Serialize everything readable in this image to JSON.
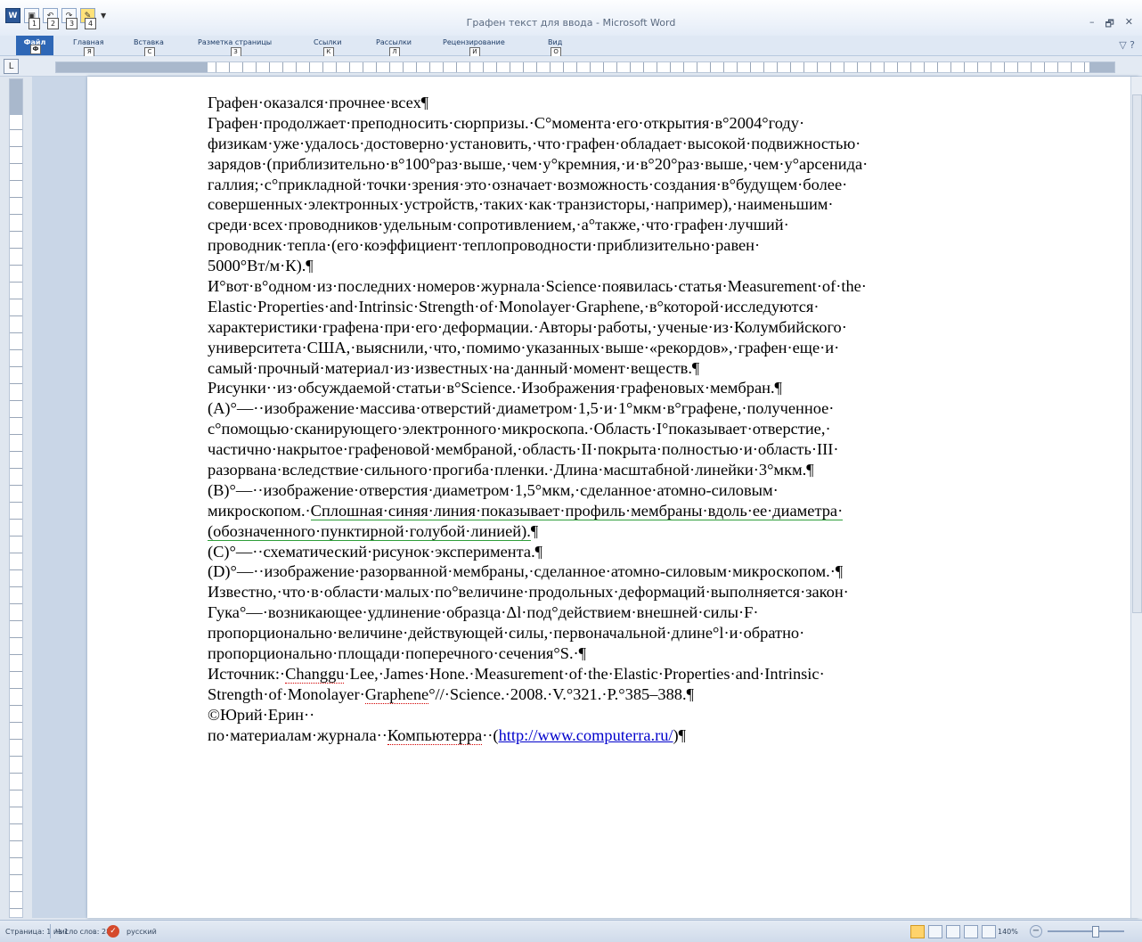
{
  "window": {
    "title": "Графен текст для  ввода - Microsoft Word",
    "controls": [
      "–",
      "🗗",
      "✕"
    ]
  },
  "qat": {
    "buttons": [
      {
        "icon": "word-logo-icon",
        "glyph": "W",
        "key": ""
      },
      {
        "icon": "save-icon",
        "glyph": "▣",
        "key": "1"
      },
      {
        "icon": "undo-icon",
        "glyph": "↶",
        "key": "2"
      },
      {
        "icon": "redo-icon",
        "glyph": "↷",
        "key": "3"
      },
      {
        "icon": "custom-icon",
        "glyph": "✎",
        "key": "4"
      }
    ],
    "more": "▼"
  },
  "ribbon": {
    "tabs": [
      {
        "label": "Файл",
        "key": "Ф"
      },
      {
        "label": "Главная",
        "key": "Я"
      },
      {
        "label": "Вставка",
        "key": "С"
      },
      {
        "label": "Разметка страницы",
        "key": "З"
      },
      {
        "label": "Ссылки",
        "key": "К"
      },
      {
        "label": "Рассылки",
        "key": "Л"
      },
      {
        "label": "Рецензирование",
        "key": "И"
      },
      {
        "label": "Вид",
        "key": "О"
      }
    ],
    "right": "▽ ?"
  },
  "ruler": {
    "corner": "L"
  },
  "document": {
    "lines": [
      {
        "segments": [
          {
            "text": "Графен·оказался·прочнее·всех¶"
          }
        ]
      },
      {
        "segments": [
          {
            "text": "Графен·продолжает·преподносить·сюрпризы.·С°момента·его·открытия·в°2004°году·"
          }
        ]
      },
      {
        "segments": [
          {
            "text": "физикам·уже·удалось·достоверно·установить,·что·графен·обладает·высокой·подвижностью·"
          }
        ]
      },
      {
        "segments": [
          {
            "text": "зарядов·(приблизительно·в°100°раз·выше,·чем·у°кремния,·и·в°20°раз·выше,·чем·у°арсенида·"
          }
        ]
      },
      {
        "segments": [
          {
            "text": "галлия;·с°прикладной·точки·зрения·это·означает·возможность·создания·в°будущем·более·"
          }
        ]
      },
      {
        "segments": [
          {
            "text": "совершенных·электронных·устройств,·таких·как·транзисторы,·например),·наименьшим·"
          }
        ]
      },
      {
        "segments": [
          {
            "text": "среди·всех·проводников·удельным·сопротивлением,·а°также,·что·графен·лучший·"
          }
        ]
      },
      {
        "segments": [
          {
            "text": "проводник·тепла·(его·коэффициент·теплопроводности·приблизительно·равен·"
          }
        ]
      },
      {
        "segments": [
          {
            "text": "5000°Вт/м·К).¶"
          }
        ]
      },
      {
        "segments": [
          {
            "text": "И°вот·в°одном·из·последних·номеров·журнала·Science·появилась·статья·Measurement·of·the·"
          }
        ]
      },
      {
        "segments": [
          {
            "text": "Elastic·Properties·and·Intrinsic·Strength·of·Monolayer·Graphene,·в°которой·исследуются·"
          }
        ]
      },
      {
        "segments": [
          {
            "text": "характеристики·графена·при·его·деформации.·Авторы·работы,·ученые·из·Колумбийского·"
          }
        ]
      },
      {
        "segments": [
          {
            "text": "университета·США,·выяснили,·что,·помимо·указанных·выше·«рекордов»,·графен·еще·и·"
          }
        ]
      },
      {
        "segments": [
          {
            "text": "самый·прочный·материал·из·известных·на·данный·момент·веществ.¶"
          }
        ]
      },
      {
        "segments": [
          {
            "text": "Рисунки··из·обсуждаемой·статьи·в°Science.·Изображения·графеновых·мембран.¶"
          }
        ]
      },
      {
        "segments": [
          {
            "text": "(A)°—··изображение·массива·отверстий·диаметром·1,5·и·1°мкм·в°графене,·полученное·"
          }
        ]
      },
      {
        "segments": [
          {
            "text": "с°помощью·сканирующего·электронного·микроскопа.·Область·I°показывает·отверстие,·"
          }
        ]
      },
      {
        "segments": [
          {
            "text": "частично·накрытое·графеновой·мембраной,·область·II·покрыта·полностью·и·область·III·"
          }
        ]
      },
      {
        "segments": [
          {
            "text": "разорвана·вследствие·сильного·прогиба·пленки.·Длина·масштабной·линейки·3°мкм.¶"
          }
        ]
      },
      {
        "segments": [
          {
            "text": "(B)°—··изображение·отверстия·диаметром·1,5°мкм,·сделанное·атомно-силовым·"
          }
        ]
      },
      {
        "segments": [
          {
            "text": "микроскопом.·"
          },
          {
            "text": "Сплошная·синяя·линия·показывает·профиль·мембраны·вдоль·ее·диаметра·",
            "style": "green"
          }
        ]
      },
      {
        "segments": [
          {
            "text": "(обозначенного·пунктирной·голубой·линией).",
            "style": "green"
          },
          {
            "text": "¶"
          }
        ]
      },
      {
        "segments": [
          {
            "text": "(C)°—··схематический·рисунок·эксперимента.¶"
          }
        ]
      },
      {
        "segments": [
          {
            "text": "(D)°—··изображение·разорванной·мембраны,·сделанное·атомно-силовым·микроскопом.·¶"
          }
        ]
      },
      {
        "segments": [
          {
            "text": "Известно,·что·в·области·малых·по°величине·продольных·деформаций·выполняется·закон·"
          }
        ]
      },
      {
        "segments": [
          {
            "text": "Гука°—·возникающее·удлинение·образца·Δl·под°действием·внешней·силы·F·"
          }
        ]
      },
      {
        "segments": [
          {
            "text": "пропорционально·величине·действующей·силы,·первоначальной·длине°l·и·обратно·"
          }
        ]
      },
      {
        "segments": [
          {
            "text": "пропорционально·площади·поперечного·сечения°S.·¶"
          }
        ]
      },
      {
        "segments": [
          {
            "text": "Источник:·"
          },
          {
            "text": "Changgu",
            "style": "red"
          },
          {
            "text": "·Lee,·James·Hone.·Measurement·of·the·Elastic·Properties·and·Intrinsic·"
          }
        ]
      },
      {
        "segments": [
          {
            "text": "Strength·of·Monolayer·"
          },
          {
            "text": "Graphene",
            "style": "red"
          },
          {
            "text": "°//·Science.·2008.·V.°321.·P.°385–388.¶"
          }
        ]
      },
      {
        "segments": [
          {
            "text": "©Юрий·Ерин··"
          }
        ]
      },
      {
        "segments": [
          {
            "text": "по·материалам·журнала··"
          },
          {
            "text": "Компьютерра",
            "style": "red"
          },
          {
            "text": "··("
          },
          {
            "text": "http://www.computerra.ru/",
            "style": "link"
          },
          {
            "text": ")¶"
          }
        ]
      }
    ]
  },
  "status": {
    "page": "Страница: 1 из 1",
    "words": "Число слов: 287",
    "language": "русский",
    "zoom": "140%",
    "zoom_level_percent": 140
  }
}
